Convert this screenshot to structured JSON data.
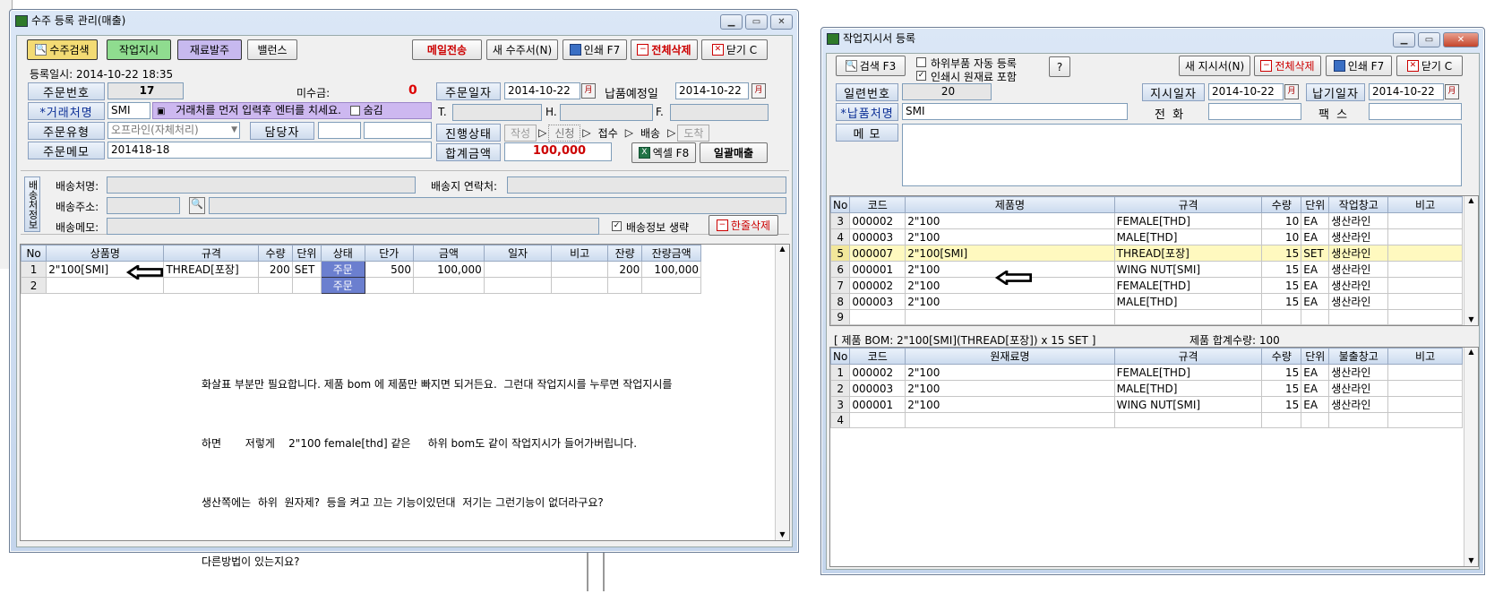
{
  "orders_window": {
    "title": "수주 등록 관리(매출)",
    "buttons": {
      "search": "수주검색",
      "work_order": "작업지시",
      "material_order": "재료발주",
      "balance": "밸런스",
      "email": "메일전송",
      "new_order": "새 수주서(N)",
      "print": "인쇄 F7",
      "delete_all": "전체삭제",
      "close": "닫기 C",
      "excel": "엑셀 F8",
      "batch_sales": "일괄매출",
      "line_delete": "한줄삭제"
    },
    "reg_datetime": "등록일시: 2014-10-22 18:35",
    "labels": {
      "order_no": "주문번호",
      "client": "*거래처명",
      "order_type": "주문유형",
      "order_memo": "주문메모",
      "unpaid": "미수금:",
      "manager": "담당자",
      "order_date": "주문일자",
      "due_date": "납품예정일",
      "progress": "진행상태",
      "total_amount": "합계금액",
      "t": "T.",
      "h": "H.",
      "f": "F.",
      "hide": "숨김",
      "ship_name": "배송처명:",
      "ship_contact": "배송지 연락처:",
      "ship_addr": "배송주소:",
      "ship_memo": "배송메모:",
      "ship_skip": "배송정보 생략",
      "ship_side": "배송처정보"
    },
    "values": {
      "order_no": "17",
      "unpaid": "0",
      "client": "SMI",
      "client_hint": "거래처를 먼저 입력후 엔터를 치세요.",
      "order_type": "오프라인(자체처리)",
      "order_memo": "201418-18",
      "order_date": "2014-10-22",
      "due_date": "2014-10-22",
      "total_amount": "100,000"
    },
    "progress_steps": [
      "작성",
      "신청",
      "접수",
      "배송",
      "도착"
    ],
    "grid": {
      "columns": [
        "No",
        "상품명",
        "규격",
        "수량",
        "단위",
        "상태",
        "단가",
        "금액",
        "일자",
        "비고",
        "잔량",
        "잔량금액"
      ],
      "rows": [
        {
          "no": "1",
          "name": "2\"100[SMI]",
          "spec": "THREAD[포장]",
          "qty": "200",
          "unit": "SET",
          "status": "주문",
          "price": "500",
          "amount": "100,000",
          "date": "",
          "note": "",
          "remain": "200",
          "remain_amount": "100,000"
        },
        {
          "no": "2",
          "name": "",
          "spec": "",
          "qty": "",
          "unit": "",
          "status": "주문",
          "price": "",
          "amount": "",
          "date": "",
          "note": "",
          "remain": "",
          "remain_amount": ""
        }
      ]
    },
    "note_lines": [
      "화살표 부분만 필요합니다. 제품 bom 에 제품만 빠지면 되거든요.  그런대 작업지시를 누루면 작업지시를",
      "하면       저렇게    2\"100 female[thd] 같은     하위 bom도 같이 작업지시가 들어가버립니다.",
      "생산쪽에는  하위  원자제?  등을 켜고 끄는 기능이있던대  저기는 그런기능이 없더라구요?",
      "다른방법이 있는지요?"
    ]
  },
  "work_window": {
    "title": "작업지시서 등록",
    "buttons": {
      "search": "검색 F3",
      "help": "?",
      "new": "새 지시서(N)",
      "delete_all": "전체삭제",
      "print": "인쇄 F7",
      "close": "닫기 C"
    },
    "checks": {
      "auto_sub": "하위부품 자동 등록",
      "include_raw": "인쇄시 원재료 포함"
    },
    "labels": {
      "serial": "일련번호",
      "delivery": "*납품처명",
      "memo": "메  모",
      "order_date": "지시일자",
      "due_date": "납기일자",
      "phone": "전  화",
      "fax": "팩  스"
    },
    "values": {
      "serial": "20",
      "delivery": "SMI",
      "order_date": "2014-10-22",
      "due_date": "2014-10-22"
    },
    "grid": {
      "columns": [
        "No",
        "코드",
        "제품명",
        "규격",
        "수량",
        "단위",
        "작업창고",
        "비고"
      ],
      "rows": [
        {
          "no": "3",
          "code": "000002",
          "name": "2\"100",
          "spec": "FEMALE[THD]",
          "qty": "10",
          "unit": "EA",
          "wh": "생산라인",
          "note": ""
        },
        {
          "no": "4",
          "code": "000003",
          "name": "2\"100",
          "spec": "MALE[THD]",
          "qty": "10",
          "unit": "EA",
          "wh": "생산라인",
          "note": ""
        },
        {
          "no": "5",
          "code": "000007",
          "name": "2\"100[SMI]",
          "spec": "THREAD[포장]",
          "qty": "15",
          "unit": "SET",
          "wh": "생산라인",
          "note": ""
        },
        {
          "no": "6",
          "code": "000001",
          "name": "2\"100",
          "spec": "WING NUT[SMI]",
          "qty": "15",
          "unit": "EA",
          "wh": "생산라인",
          "note": ""
        },
        {
          "no": "7",
          "code": "000002",
          "name": "2\"100",
          "spec": "FEMALE[THD]",
          "qty": "15",
          "unit": "EA",
          "wh": "생산라인",
          "note": ""
        },
        {
          "no": "8",
          "code": "000003",
          "name": "2\"100",
          "spec": "MALE[THD]",
          "qty": "15",
          "unit": "EA",
          "wh": "생산라인",
          "note": ""
        },
        {
          "no": "9",
          "code": "",
          "name": "",
          "spec": "",
          "qty": "",
          "unit": "",
          "wh": "",
          "note": ""
        }
      ]
    },
    "bom_caption": "[ 제품 BOM: 2\"100[SMI](THREAD[포장]) x 15 SET ]",
    "bom_total": "제품 합계수량: 100",
    "bom_grid": {
      "columns": [
        "No",
        "코드",
        "원재료명",
        "규격",
        "수량",
        "단위",
        "불출창고",
        "비고"
      ],
      "rows": [
        {
          "no": "1",
          "code": "000002",
          "name": "2\"100",
          "spec": "FEMALE[THD]",
          "qty": "15",
          "unit": "EA",
          "wh": "생산라인",
          "note": ""
        },
        {
          "no": "2",
          "code": "000003",
          "name": "2\"100",
          "spec": "MALE[THD]",
          "qty": "15",
          "unit": "EA",
          "wh": "생산라인",
          "note": ""
        },
        {
          "no": "3",
          "code": "000001",
          "name": "2\"100",
          "spec": "WING NUT[SMI]",
          "qty": "15",
          "unit": "EA",
          "wh": "생산라인",
          "note": ""
        },
        {
          "no": "4",
          "code": "",
          "name": "",
          "spec": "",
          "qty": "",
          "unit": "",
          "wh": "",
          "note": ""
        }
      ]
    }
  },
  "colors": {
    "highlight_row": "#fff9bf",
    "status_cell": "#6b7fcf",
    "accent_red": "#cc0000"
  }
}
